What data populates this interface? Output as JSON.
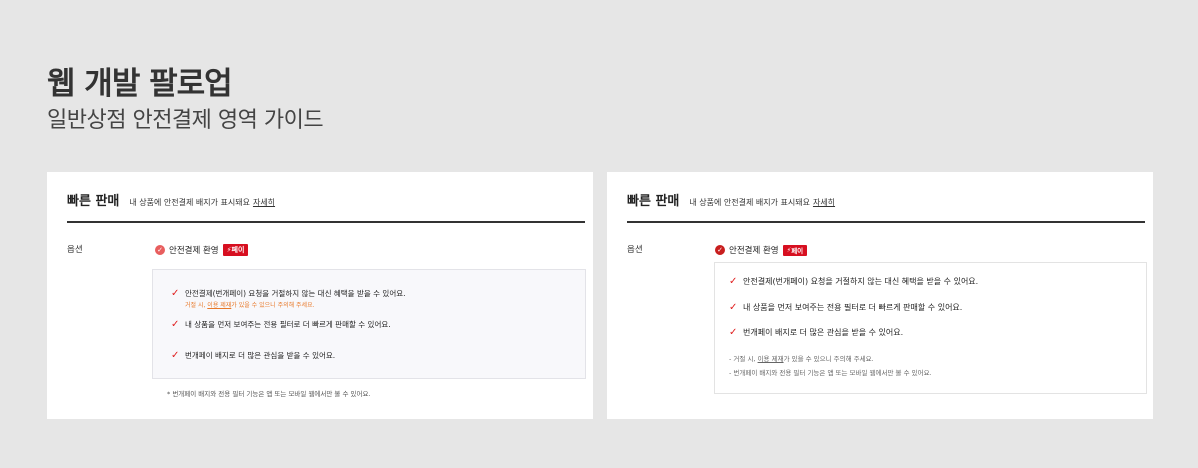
{
  "header": {
    "title": "웹 개발 팔로업",
    "subtitle": "일반상점 안전결제 영역 가이드"
  },
  "left_card": {
    "title": "빠른 판매",
    "desc": "내 상품에 안전결제 배지가 표시돼요",
    "link": "자세히",
    "option_label": "옵션",
    "option_text": "안전결제 환영",
    "badge": "페이",
    "benefits": [
      "안전결제(번개페이) 요청을 거절하지 않는 대신 혜택을 받을 수 있어요.",
      "내 상품을 먼저 보여주는 전용 필터로 더 빠르게 판매할 수 있어요.",
      "번개페이 배지로 더 많은 관심을 받을 수 있어요."
    ],
    "warn_prefix": "거절 시, ",
    "warn_link": "이용 제재",
    "warn_suffix": "가 있을 수 있으니 주의해 주세요.",
    "footnote": "* 번개페이 배지와 전용 필터 기능은 앱 또는 모바일 웹에서만 볼 수 있어요."
  },
  "right_card": {
    "title": "빠른 판매",
    "desc": "내 상품에 안전결제 배지가 표시돼요",
    "link": "자세히",
    "option_label": "옵션",
    "option_text": "안전결제 환영",
    "badge": "페이",
    "benefits": [
      "안전결제(번개페이) 요청을 거절하지 않는 대신 혜택을 받을 수 있어요.",
      "내 상품을 먼저 보여주는 전용 필터로 더 빠르게 판매할 수 있어요.",
      "번개페이 배지로 더 많은 관심을 받을 수 있어요."
    ],
    "note1_prefix": "-  거절 시, ",
    "note1_link": "이용 제재",
    "note1_suffix": "가 있을 수 있으니 주의해 주세요.",
    "note2": "-  번개페이 배지와 전용 필터 기능은 앱 또는 모바일 웹에서만 볼 수 있어요."
  },
  "colors": {
    "accent_red": "#d70f20",
    "warn_orange": "#e8792a"
  },
  "icons": {
    "check": "check-icon",
    "radio": "radio-checked-icon",
    "bolt": "lightning-icon"
  }
}
